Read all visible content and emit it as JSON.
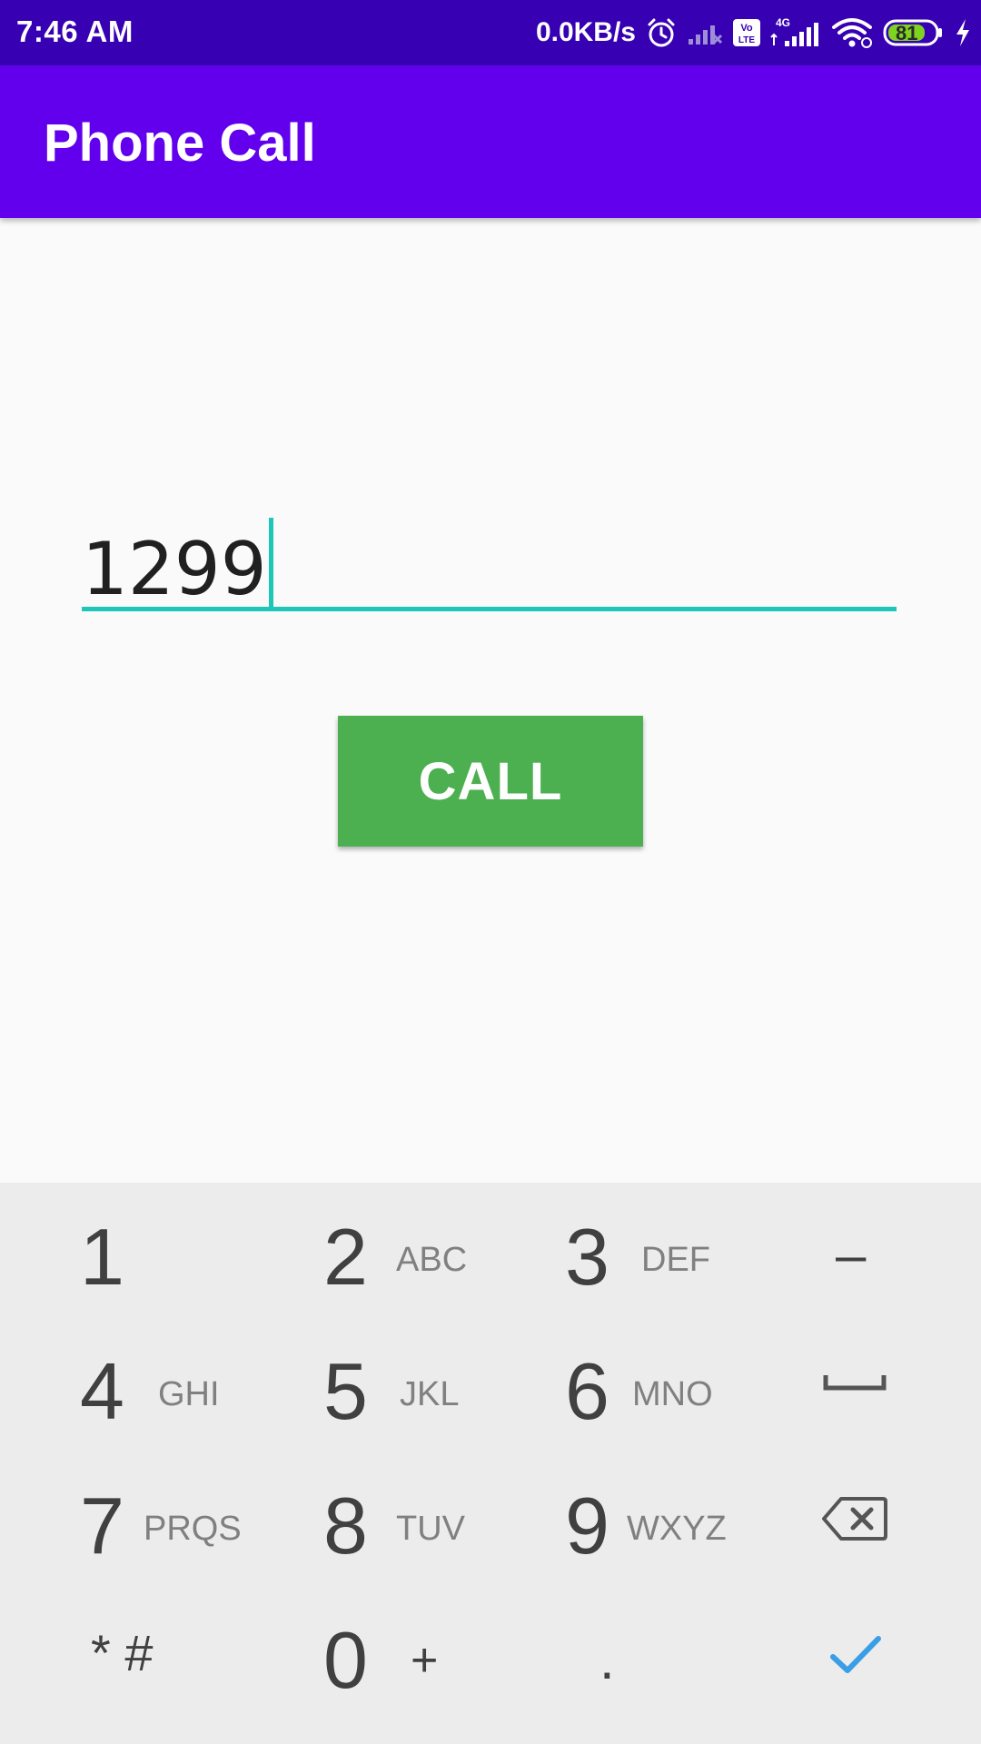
{
  "status_bar": {
    "time": "7:46 AM",
    "net_speed": "0.0KB/s",
    "battery": "81",
    "volte_badge": "Vo LTE",
    "network_type": "4G",
    "icons": [
      "alarm-icon",
      "signal-weak-icon",
      "volte-icon",
      "signal-4g-icon",
      "wifi-icon",
      "battery-icon",
      "charging-icon"
    ]
  },
  "app_bar": {
    "title": "Phone Call"
  },
  "form": {
    "phone_value": "1299",
    "call_label": "CALL"
  },
  "keypad": {
    "rows": [
      [
        {
          "digit": "1",
          "letters": ""
        },
        {
          "digit": "2",
          "letters": "ABC"
        },
        {
          "digit": "3",
          "letters": "DEF"
        },
        {
          "symbol": "–",
          "name": "minus"
        }
      ],
      [
        {
          "digit": "4",
          "letters": "GHI"
        },
        {
          "digit": "5",
          "letters": "JKL"
        },
        {
          "digit": "6",
          "letters": "MNO"
        },
        {
          "icon": "space-icon"
        }
      ],
      [
        {
          "digit": "7",
          "letters": "PRQS"
        },
        {
          "digit": "8",
          "letters": "TUV"
        },
        {
          "digit": "9",
          "letters": "WXYZ"
        },
        {
          "icon": "backspace-icon"
        }
      ],
      [
        {
          "symbol": "* #",
          "name": "star-hash"
        },
        {
          "digit": "0",
          "letters": "+"
        },
        {
          "symbol": ".",
          "name": "period"
        },
        {
          "icon": "checkmark-icon"
        }
      ]
    ]
  },
  "colors": {
    "status_bar": "#3700b3",
    "app_bar": "#6200ee",
    "accent": "#1cc6b8",
    "call_button": "#4caf50",
    "keypad_bg": "#ececec",
    "check": "#3a9ee6"
  }
}
